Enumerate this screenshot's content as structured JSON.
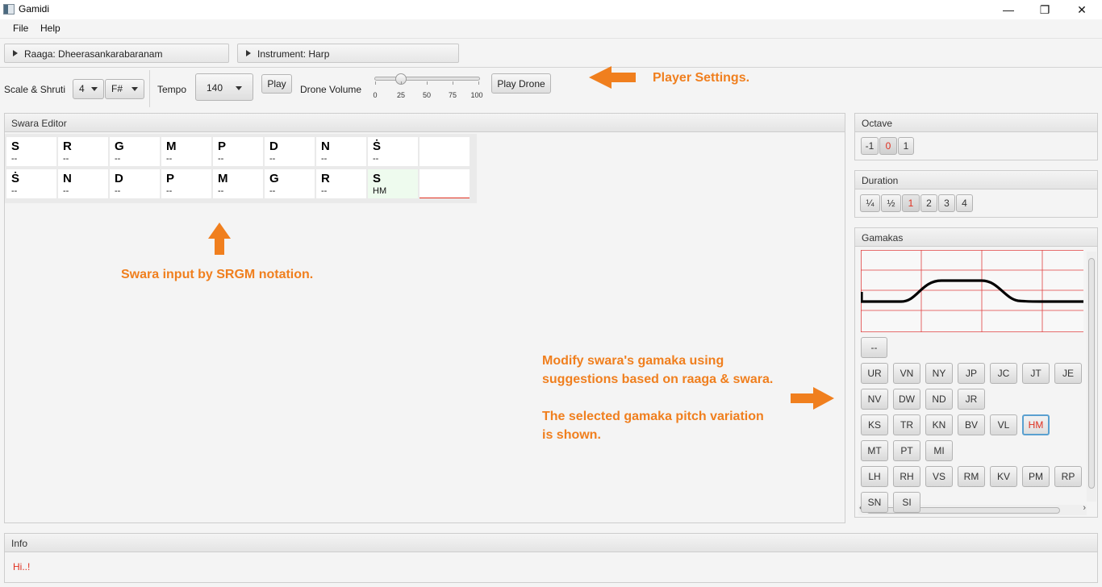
{
  "window": {
    "title": "Gamidi",
    "minimize": "—",
    "restore": "❐",
    "close": "✕"
  },
  "menu": [
    "File",
    "Help"
  ],
  "raaga_pane": "Raaga: Dheerasankarabaranam",
  "instrument_pane": "Instrument: Harp",
  "player": {
    "scale_label": "Scale & Shruti",
    "scale_value": "4",
    "shruti_value": "F#",
    "tempo_label": "Tempo",
    "tempo_value": "140",
    "play_label": "Play",
    "drone_volume_label": "Drone Volume",
    "drone_volume_value": 25,
    "slider_ticks": [
      "0",
      "25",
      "50",
      "75",
      "100"
    ],
    "play_drone_label": "Play Drone"
  },
  "annotations": {
    "player": "Player Settings.",
    "swara": "Swara input by SRGM notation.",
    "gamaka1": "Modify swara's gamaka using",
    "gamaka2": "suggestions based on raaga & swara.",
    "gamaka3": "The selected gamaka pitch variation",
    "gamaka4": "is shown."
  },
  "swara_editor": {
    "title": "Swara Editor",
    "rows": [
      [
        {
          "s": "S",
          "g": "--"
        },
        {
          "s": "R",
          "g": "--"
        },
        {
          "s": "G",
          "g": "--"
        },
        {
          "s": "M",
          "g": "--"
        },
        {
          "s": "P",
          "g": "--"
        },
        {
          "s": "D",
          "g": "--"
        },
        {
          "s": "N",
          "g": "--"
        },
        {
          "s": "Ṡ",
          "g": "--"
        },
        {
          "s": "",
          "g": ""
        }
      ],
      [
        {
          "s": "Ṡ",
          "g": "--"
        },
        {
          "s": "N",
          "g": "--"
        },
        {
          "s": "D",
          "g": "--"
        },
        {
          "s": "P",
          "g": "--"
        },
        {
          "s": "M",
          "g": "--"
        },
        {
          "s": "G",
          "g": "--"
        },
        {
          "s": "R",
          "g": "--"
        },
        {
          "s": "S",
          "g": "HM"
        },
        {
          "s": "",
          "g": ""
        }
      ]
    ]
  },
  "octave": {
    "title": "Octave",
    "options": [
      "-1",
      "0",
      "1"
    ],
    "selected": "0"
  },
  "duration": {
    "title": "Duration",
    "options": [
      "¼",
      "½",
      "1",
      "2",
      "3",
      "4"
    ],
    "selected": "1"
  },
  "gamakas": {
    "title": "Gamakas",
    "none_label": "--",
    "rows": [
      [
        "UR",
        "VN",
        "NY",
        "JP",
        "JC",
        "JT",
        "JE"
      ],
      [
        "NV",
        "DW",
        "ND",
        "JR"
      ],
      [
        "KS",
        "TR",
        "KN",
        "BV",
        "VL",
        "HM"
      ],
      [
        "MT",
        "PT",
        "MI"
      ],
      [
        "LH",
        "RH",
        "VS",
        "RM",
        "KV",
        "PM",
        "RP"
      ],
      [
        "SN",
        "SI"
      ]
    ],
    "selected": "HM"
  },
  "info": {
    "title": "Info",
    "message": "Hi..!"
  },
  "colors": {
    "accent_orange": "#f07f1e",
    "selected_red": "#e03020",
    "focus_blue": "#5aa0d0"
  }
}
